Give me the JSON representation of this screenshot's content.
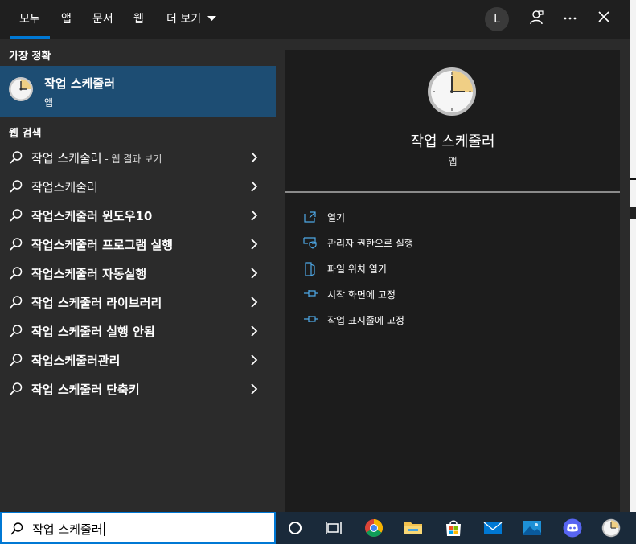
{
  "tabs": [
    "모두",
    "앱",
    "문서",
    "웹",
    "더 보기"
  ],
  "account_initial": "L",
  "best_match": {
    "section_label": "가장 정확",
    "title": "작업 스케줄러",
    "type": "앱"
  },
  "web_search": {
    "section_label": "웹 검색",
    "items": [
      {
        "text": "작업 스케줄러",
        "suffix": " - 웹 결과 보기"
      },
      {
        "text": "작업스케줄러",
        "suffix": ""
      },
      {
        "text": "작업스케줄러 윈도우10",
        "suffix": ""
      },
      {
        "text": "작업스케줄러 프로그램 실행",
        "suffix": ""
      },
      {
        "text": "작업스케줄러 자동실행",
        "suffix": ""
      },
      {
        "text": "작업 스케줄러 라이브러리",
        "suffix": ""
      },
      {
        "text": "작업 스케줄러 실행 안됨",
        "suffix": ""
      },
      {
        "text": "작업스케줄러관리",
        "suffix": ""
      },
      {
        "text": "작업 스케줄러 단축키",
        "suffix": ""
      }
    ]
  },
  "detail": {
    "title": "작업 스케줄러",
    "type": "앱",
    "actions": [
      {
        "label": "열기",
        "icon": "open-icon"
      },
      {
        "label": "관리자 권한으로 실행",
        "icon": "shield-icon"
      },
      {
        "label": "파일 위치 열기",
        "icon": "file-location-icon"
      },
      {
        "label": "시작 화면에 고정",
        "icon": "pin-icon"
      },
      {
        "label": "작업 표시줄에 고정",
        "icon": "pin-icon"
      }
    ]
  },
  "search": {
    "value": "작업 스케줄러"
  },
  "colors": {
    "accent": "#0078d4",
    "selected_row": "#1d4d73",
    "panel": "#2b2b2b",
    "detail_panel": "#1c1c1c"
  }
}
